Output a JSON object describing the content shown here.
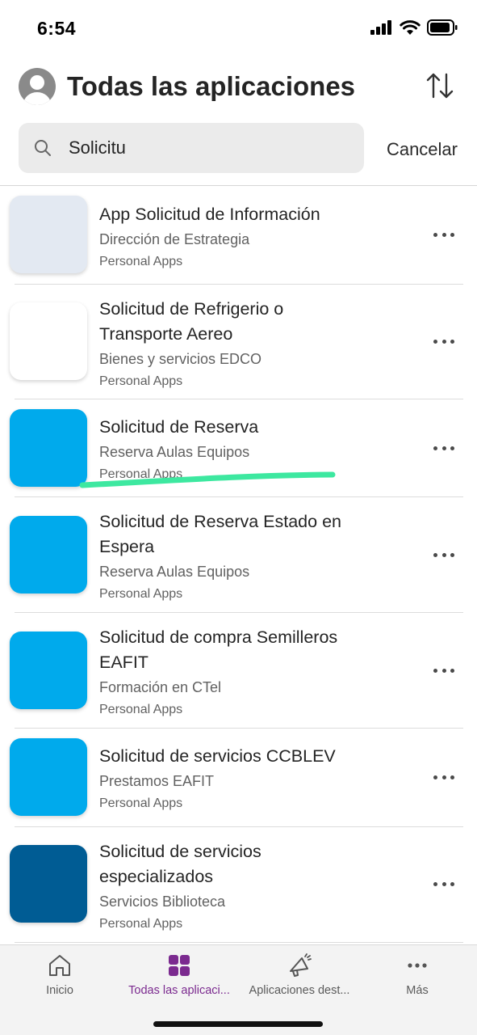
{
  "status_bar": {
    "time": "6:54"
  },
  "header": {
    "title": "Todas las aplicaciones"
  },
  "search": {
    "value": "Solicitu",
    "cancel_label": "Cancelar"
  },
  "apps": [
    {
      "name": "App Solicitud de Información",
      "environment": "Dirección de Estrategia",
      "type": "Personal Apps",
      "tile_color": "#e3e9f2"
    },
    {
      "name": "Solicitud de Refrigerio o Transporte Aereo",
      "environment": "Bienes y servicios EDCO",
      "type": "Personal Apps",
      "tile_color": "#ffffff"
    },
    {
      "name": "Solicitud de Reserva",
      "environment": "Reserva Aulas Equipos",
      "type": "Personal Apps",
      "tile_color": "#00aaec"
    },
    {
      "name": "Solicitud de Reserva Estado en Espera",
      "environment": "Reserva Aulas Equipos",
      "type": "Personal Apps",
      "tile_color": "#00aaec"
    },
    {
      "name": "Solicitud de compra Semilleros EAFIT",
      "environment": "Formación en CTel",
      "type": "Personal Apps",
      "tile_color": "#00aaec"
    },
    {
      "name": "Solicitud de servicios CCBLEV",
      "environment": "Prestamos EAFIT",
      "type": "Personal Apps",
      "tile_color": "#00aaec"
    },
    {
      "name": "Solicitud de servicios especializados",
      "environment": "Servicios Biblioteca",
      "type": "Personal Apps",
      "tile_color": "#005c94"
    }
  ],
  "bottom_nav": {
    "items": [
      {
        "label": "Inicio",
        "icon": "home-icon"
      },
      {
        "label": "Todas las aplicaci...",
        "icon": "apps-grid-icon",
        "active": true
      },
      {
        "label": "Aplicaciones dest...",
        "icon": "megaphone-icon"
      },
      {
        "label": "Más",
        "icon": "more-icon"
      }
    ]
  },
  "colors": {
    "accent": "#7b2a8f",
    "highlight_stroke": "#3de8a0"
  }
}
